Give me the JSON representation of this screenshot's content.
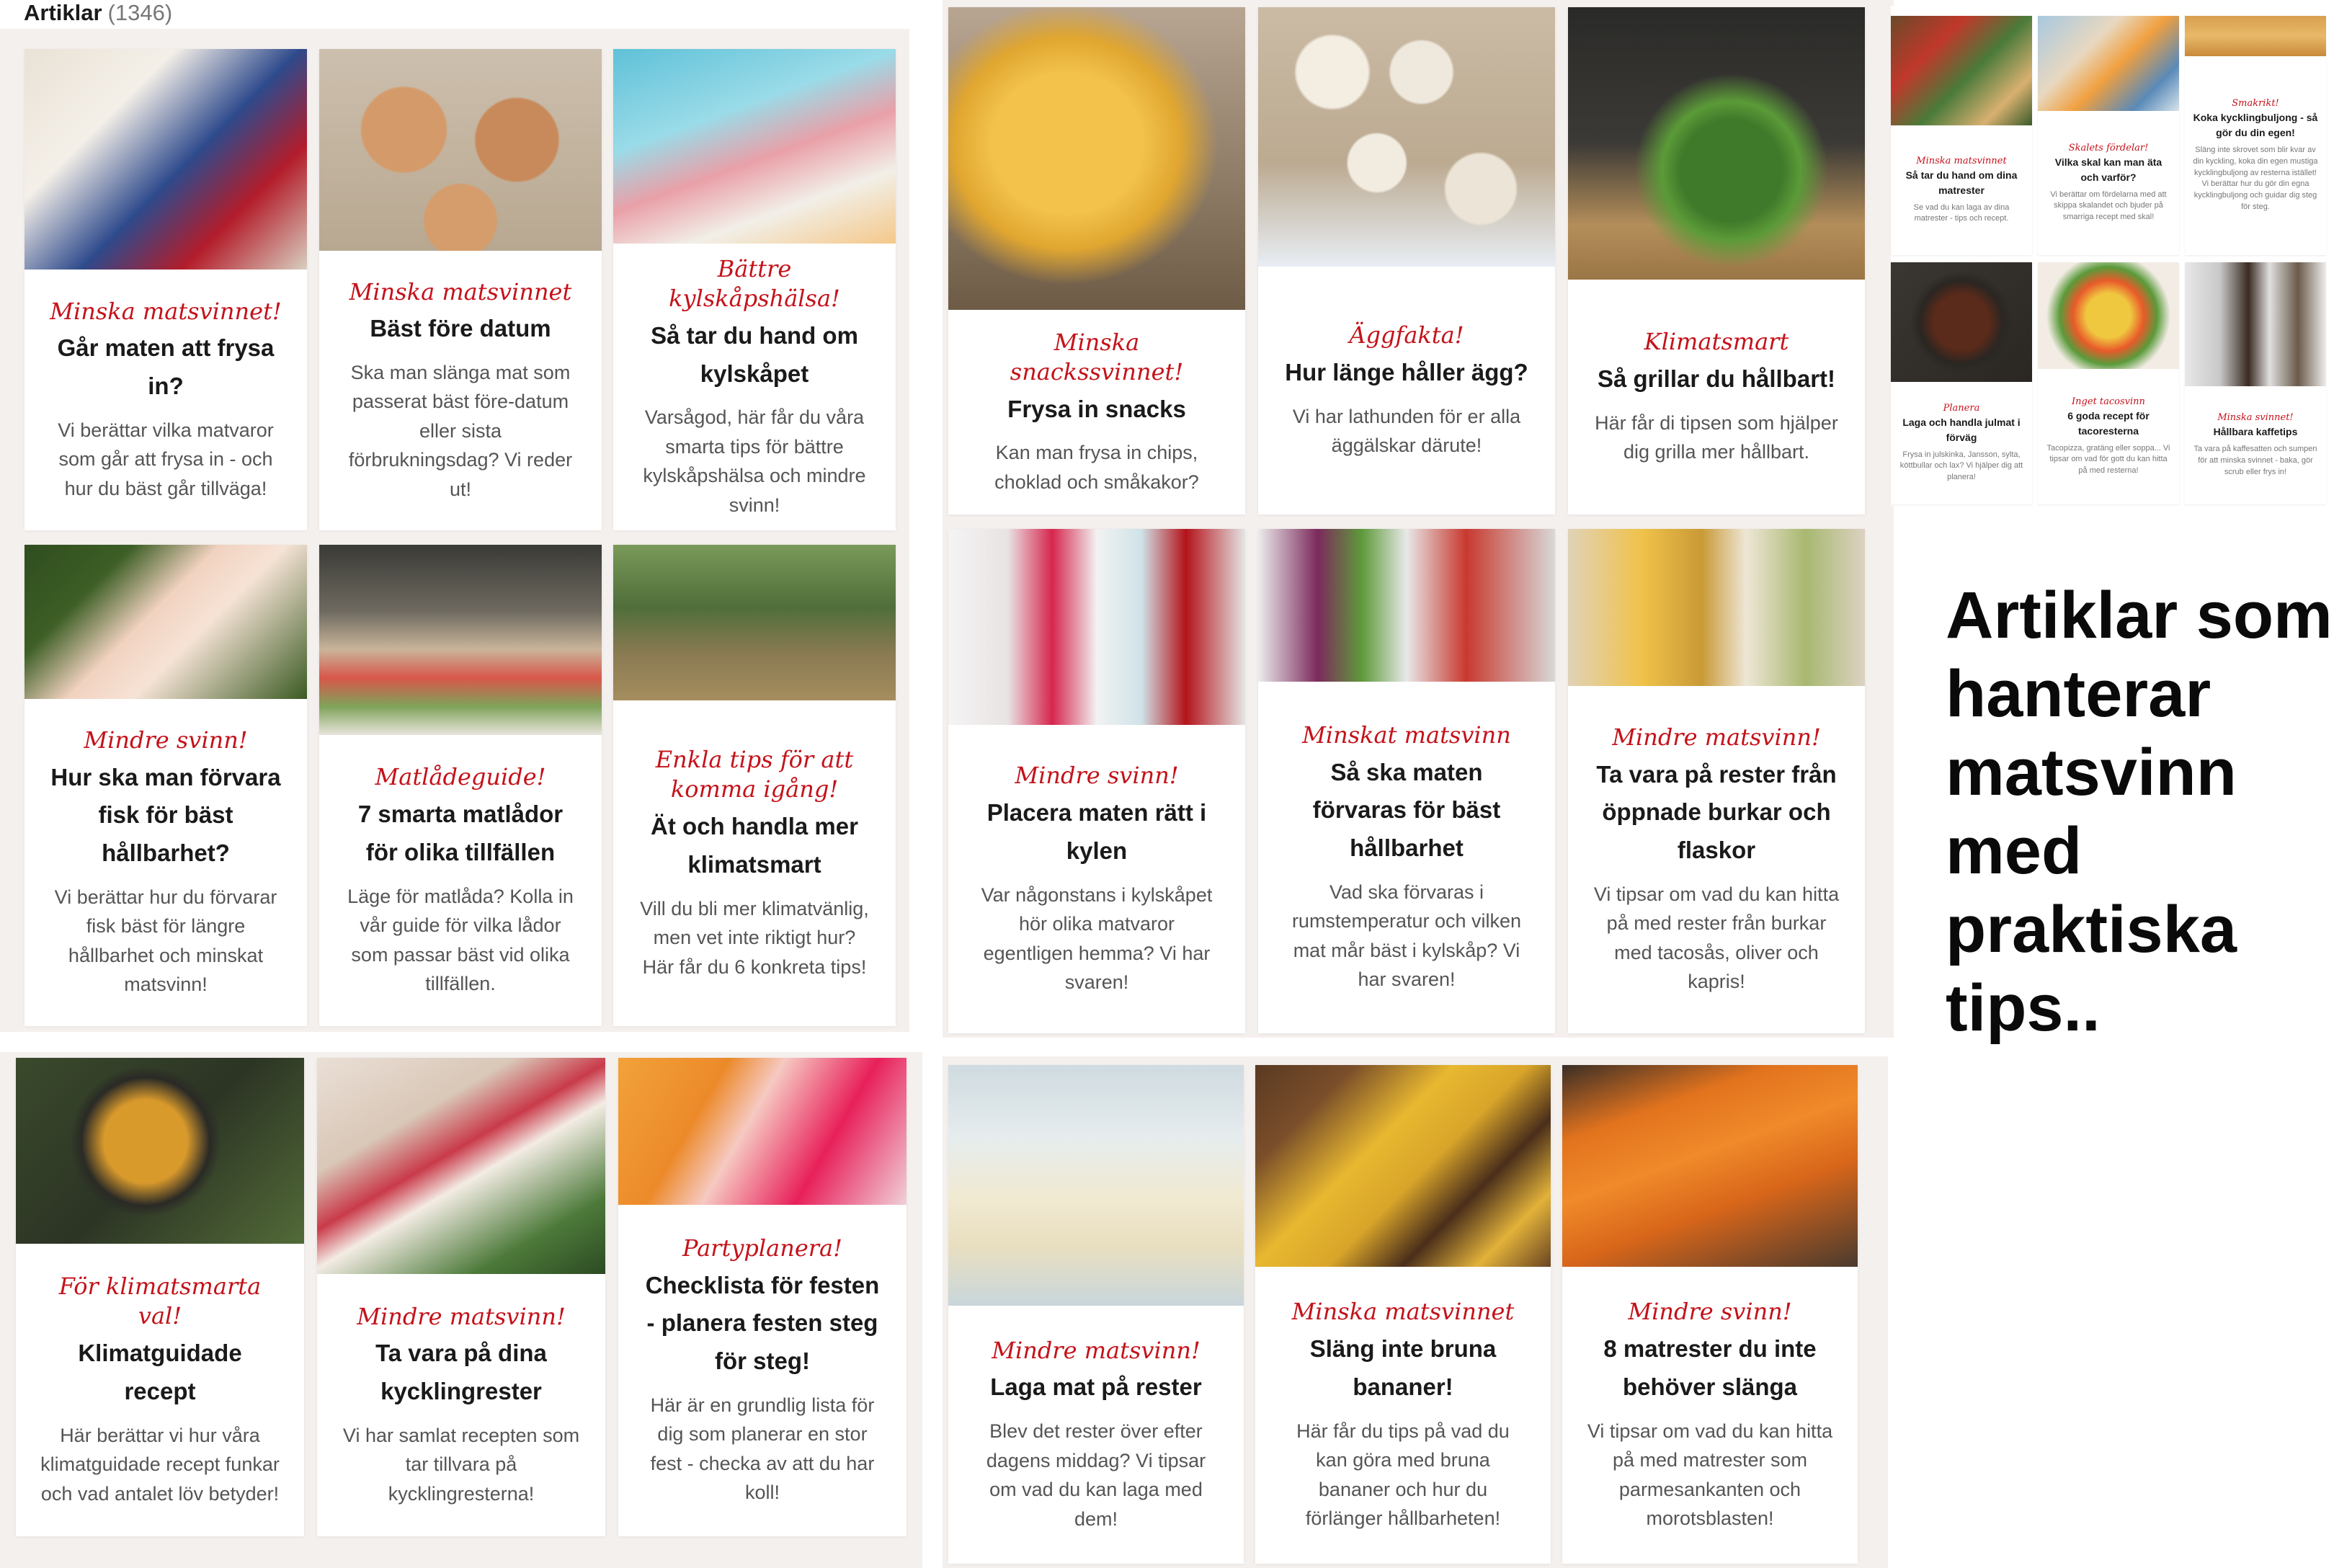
{
  "header": {
    "title": "Artiklar",
    "count": "(1346)"
  },
  "headline": "Artiklar som hanterar matsvinn med praktiska tips..",
  "cards": [
    {
      "kicker": "Minska matsvinnet!",
      "title": "Går maten att frysa in?",
      "desc": "Vi berättar vilka matvaror som går att frysa in - och hur du bäst går tillväga!"
    },
    {
      "kicker": "Minska matsvinnet",
      "title": "Bäst före datum",
      "desc": "Ska man slänga mat som passerat bäst före-datum eller sista förbrukningsdag? Vi reder ut!"
    },
    {
      "kicker": "Bättre kylskåpshälsa!",
      "title": "Så tar du hand om kylskåpet",
      "desc": "Varsågod, här får du våra smarta tips för bättre kylskåpshälsa och mindre svinn!"
    },
    {
      "kicker": "Minska snackssvinnet!",
      "title": "Frysa in snacks",
      "desc": "Kan man frysa in chips, choklad och småkakor?"
    },
    {
      "kicker": "Äggfakta!",
      "title": "Hur länge håller ägg?",
      "desc": "Vi har lathunden för er alla äggälskar därute!"
    },
    {
      "kicker": "Klimatsmart",
      "title": "Så grillar du hållbart!",
      "desc": "Här får di tipsen som hjälper dig grilla mer hållbart."
    },
    {
      "kicker": "Mindre svinn!",
      "title": "Hur ska man förvara fisk för bäst hållbarhet?",
      "desc": "Vi berättar hur du förvarar fisk bäst för längre hållbarhet och minskat matsvinn!"
    },
    {
      "kicker": "Matlådeguide!",
      "title": "7 smarta matlådor för olika tillfällen",
      "desc": "Läge för matlåda? Kolla in vår guide för vilka lådor som passar bäst vid olika tillfällen."
    },
    {
      "kicker": "Enkla tips för att komma igång!",
      "title": "Ät och handla mer klimatsmart",
      "desc": "Vill du bli mer klimatvänlig, men vet inte riktigt hur? Här får du 6 konkreta tips!"
    },
    {
      "kicker": "Mindre svinn!",
      "title": "Placera maten rätt i kylen",
      "desc": "Var någonstans i kylskåpet hör olika matvaror egentligen hemma? Vi har svaren!"
    },
    {
      "kicker": "Minskat matsvinn",
      "title": "Så ska maten förvaras för bäst hållbarhet",
      "desc": "Vad ska förvaras i rumstemperatur och vilken mat mår bäst i kylskåp? Vi har svaren!"
    },
    {
      "kicker": "Mindre matsvinn!",
      "title": "Ta vara på rester från öppnade burkar och flaskor",
      "desc": "Vi tipsar om vad du kan hitta på med rester från burkar med tacosås, oliver och kapris!"
    },
    {
      "kicker": "För klimatsmarta val!",
      "title": "Klimatguidade recept",
      "desc": "Här berättar vi hur våra klimatguidade recept funkar och vad antalet löv betyder!"
    },
    {
      "kicker": "Mindre matsvinn!",
      "title": "Ta vara på dina kycklingrester",
      "desc": "Vi har samlat recepten som tar tillvara på kycklingresterna!"
    },
    {
      "kicker": "Partyplanera!",
      "title": "Checklista för festen - planera festen steg för steg!",
      "desc": "Här är en grundlig lista för dig som planerar en stor fest - checka av att du har koll!"
    },
    {
      "kicker": "Mindre matsvinn!",
      "title": "Laga mat på rester",
      "desc": "Blev det rester över efter dagens middag? Vi tipsar om vad du kan laga med dem!"
    },
    {
      "kicker": "Minska matsvinnet",
      "title": "Släng inte bruna bananer!",
      "desc": "Här får du tips på vad du kan göra med bruna bananer och hur du förlänger hållbarheten!"
    },
    {
      "kicker": "Mindre svinn!",
      "title": "8 matrester du inte behöver slänga",
      "desc": "Vi tipsar om vad du kan hitta på med matrester som parmesankanten och morotsblasten!"
    }
  ],
  "thumbs": [
    {
      "kicker": "Minska matsvinnet",
      "title": "Så tar du hand om dina matrester",
      "desc": "Se vad du kan laga av dina matrester - tips och recept."
    },
    {
      "kicker": "Skalets fördelar!",
      "title": "Vilka skal kan man äta och varför?",
      "desc": "Vi berättar om fördelarna med att skippa skalandet och bjuder på smarriga recept med skal!"
    },
    {
      "kicker": "Smakrikt!",
      "title": "Koka kycklingbuljong - så gör du din egen!",
      "desc": "Släng inte skrovet som blir kvar av din kyckling, koka din egen mustiga kycklingbuljong av resterna istället! Vi berättar hur du gör din egna kycklingbuljong och guidar dig steg för steg."
    },
    {
      "kicker": "Planera",
      "title": "Laga och handla julmat i förväg",
      "desc": "Frysa in julskinka, Jansson, sylta, köttbullar och lax? Vi hjälper dig att planera!"
    },
    {
      "kicker": "Inget tacosvinn",
      "title": "6 goda recept för tacoresterna",
      "desc": "Tacopizza, gratäng eller soppa... Vi tipsar om vad för gott du kan hitta på med resterna!"
    },
    {
      "kicker": "Minska svinnet!",
      "title": "Hållbara kaffetips",
      "desc": "Ta vara på kaffesatten och sumpen för att minska svinnet - baka, gör scrub eller frys in!"
    }
  ]
}
